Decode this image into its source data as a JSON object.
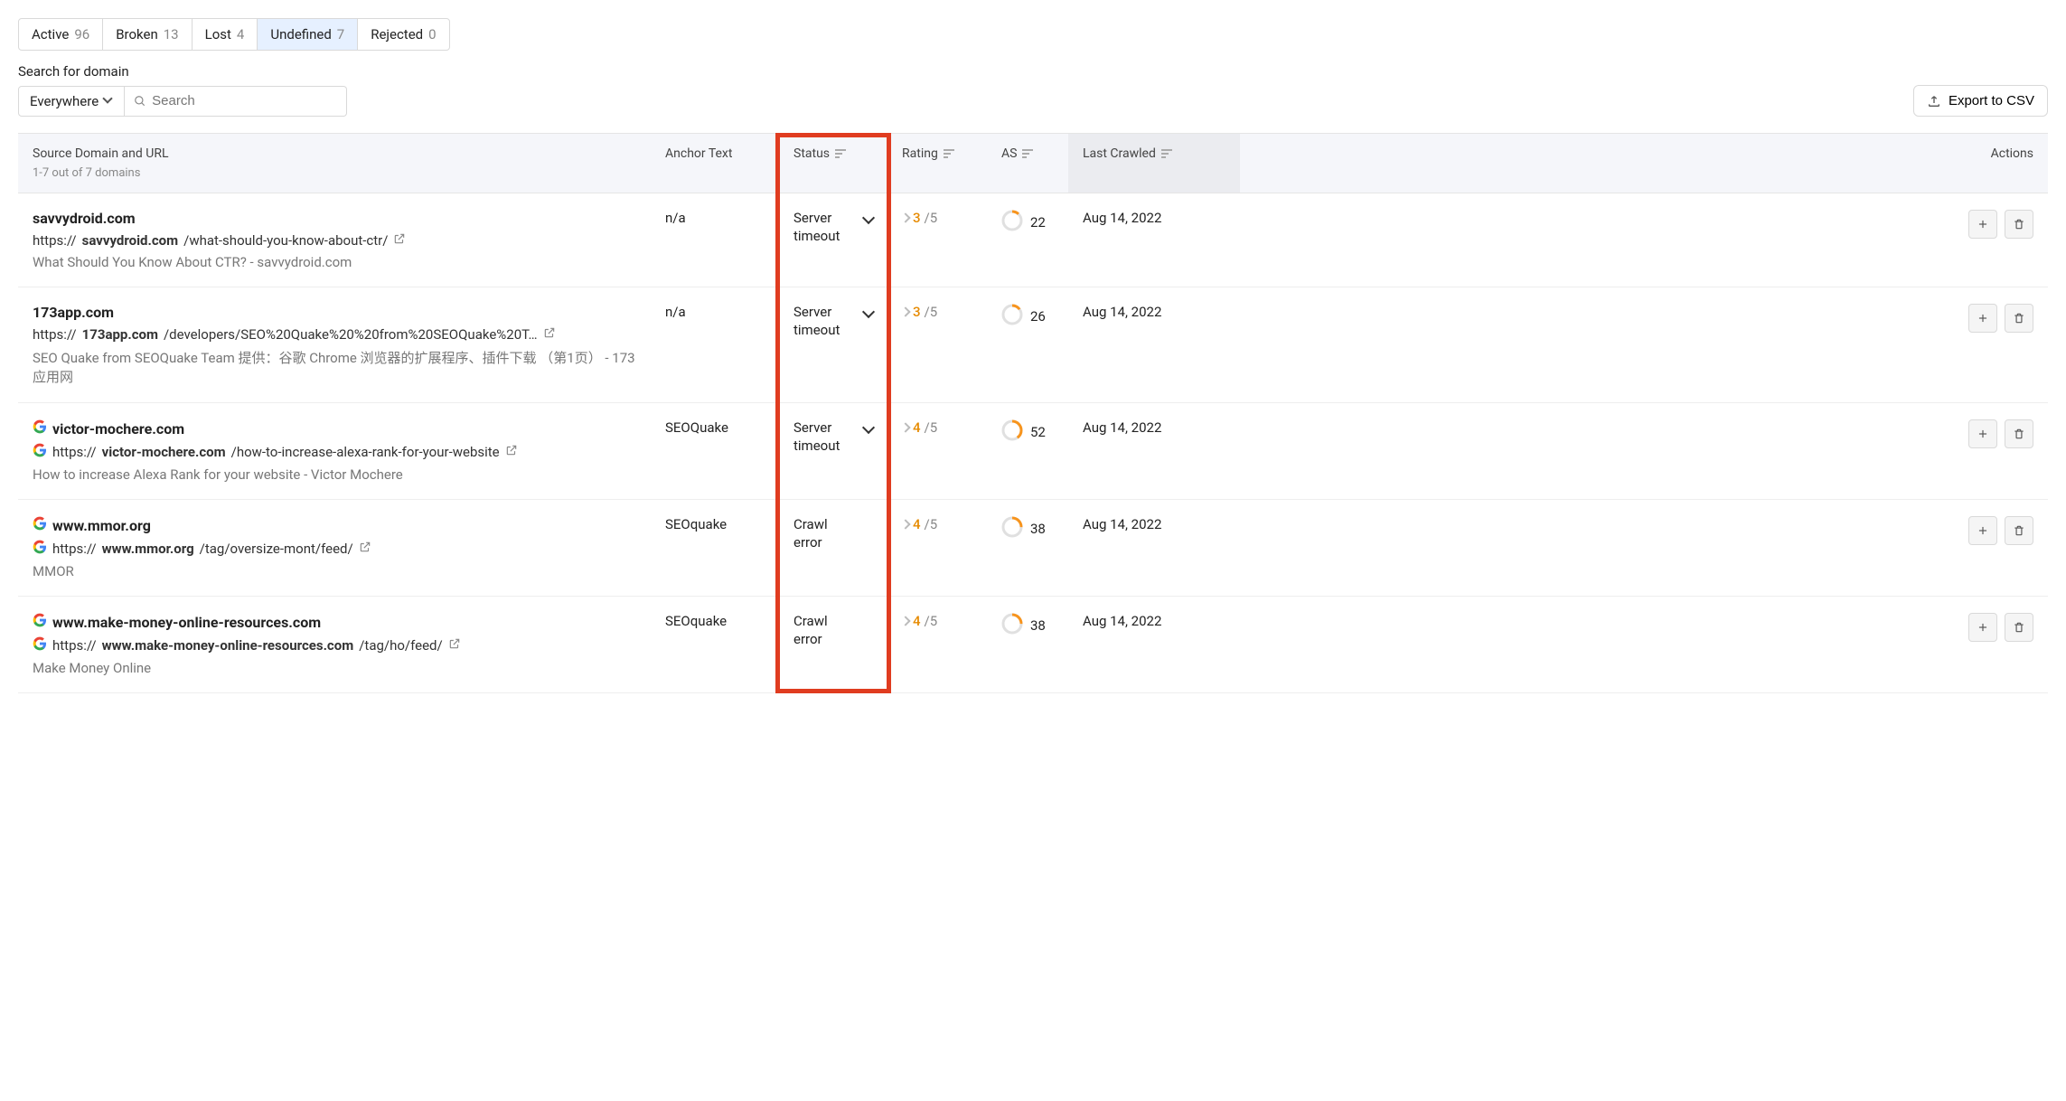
{
  "tabs": [
    {
      "label": "Active",
      "count": "96"
    },
    {
      "label": "Broken",
      "count": "13"
    },
    {
      "label": "Lost",
      "count": "4"
    },
    {
      "label": "Undefined",
      "count": "7"
    },
    {
      "label": "Rejected",
      "count": "0"
    }
  ],
  "active_tab_index": 3,
  "search": {
    "label": "Search for domain",
    "scope": "Everywhere",
    "placeholder": "Search"
  },
  "export_label": "Export to CSV",
  "columns": {
    "source": "Source Domain and URL",
    "source_sub": "1-7 out of 7 domains",
    "anchor": "Anchor Text",
    "status": "Status",
    "rating": "Rating",
    "as": "AS",
    "crawled": "Last Crawled",
    "actions": "Actions"
  },
  "rows": [
    {
      "domain": "savvydroid.com",
      "has_favicon": false,
      "url_prefix": "https://",
      "url_bold": "savvydroid.com",
      "url_rest": "/what-should-you-know-about-ctr/",
      "title": "What Should You Know About CTR? - savvydroid.com",
      "anchor": "n/a",
      "status": "Server timeout",
      "status_chevron": true,
      "rating_num": "3",
      "rating_total": "/5",
      "as": "22",
      "as_pct": 12,
      "crawled": "Aug 14, 2022"
    },
    {
      "domain": "173app.com",
      "has_favicon": false,
      "url_prefix": "https://",
      "url_bold": "173app.com",
      "url_rest": "/developers/SEO%20Quake%20%20from%20SEOQuake%20T…",
      "title": "SEO Quake from SEOQuake Team 提供：谷歌 Chrome 浏览器的扩展程序、插件下载 （第1页） - 173应用网",
      "anchor": "n/a",
      "status": "Server timeout",
      "status_chevron": true,
      "rating_num": "3",
      "rating_total": "/5",
      "as": "26",
      "as_pct": 15,
      "crawled": "Aug 14, 2022"
    },
    {
      "domain": "victor-mochere.com",
      "has_favicon": true,
      "url_prefix": "https://",
      "url_bold": "victor-mochere.com",
      "url_rest": "/how-to-increase-alexa-rank-for-your-website",
      "title": "How to increase Alexa Rank for your website - Victor Mochere",
      "anchor": "SEOQuake",
      "status": "Server timeout",
      "status_chevron": true,
      "rating_num": "4",
      "rating_total": "/5",
      "as": "52",
      "as_pct": 40,
      "crawled": "Aug 14, 2022"
    },
    {
      "domain": "www.mmor.org",
      "has_favicon": true,
      "url_prefix": "https://",
      "url_bold": "www.mmor.org",
      "url_rest": "/tag/oversize-mont/feed/",
      "title": "MMOR",
      "anchor": "SEOquake",
      "status": "Crawl error",
      "status_chevron": false,
      "rating_num": "4",
      "rating_total": "/5",
      "as": "38",
      "as_pct": 25,
      "crawled": "Aug 14, 2022"
    },
    {
      "domain": "www.make-money-online-resources.com",
      "has_favicon": true,
      "url_prefix": "https://",
      "url_bold": "www.make-money-online-resources.com",
      "url_rest": "/tag/ho/feed/",
      "title": "Make Money Online",
      "anchor": "SEOquake",
      "status": "Crawl error",
      "status_chevron": false,
      "rating_num": "4",
      "rating_total": "/5",
      "as": "38",
      "as_pct": 25,
      "crawled": "Aug 14, 2022"
    }
  ]
}
